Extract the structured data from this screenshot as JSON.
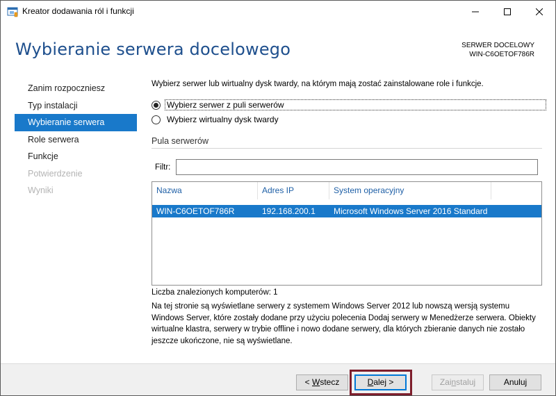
{
  "window": {
    "title": "Kreator dodawania ról i funkcji",
    "app_icon": "server-manager-icon",
    "controls": [
      "minimize-icon",
      "maximize-icon",
      "close-icon"
    ]
  },
  "header": {
    "title": "Wybieranie serwera docelowego",
    "target_label": "SERWER DOCELOWY",
    "target_value": "WIN-C6OETOF786R"
  },
  "nav": {
    "items": [
      {
        "label": "Zanim rozpoczniesz",
        "state": "normal"
      },
      {
        "label": "Typ instalacji",
        "state": "normal"
      },
      {
        "label": "Wybieranie serwera",
        "state": "active"
      },
      {
        "label": "Role serwera",
        "state": "normal"
      },
      {
        "label": "Funkcje",
        "state": "normal"
      },
      {
        "label": "Potwierdzenie",
        "state": "disabled"
      },
      {
        "label": "Wyniki",
        "state": "disabled"
      }
    ]
  },
  "main": {
    "description": "Wybierz serwer lub wirtualny dysk twardy, na którym mają zostać zainstalowane role i funkcje.",
    "options": [
      {
        "label": "Wybierz serwer z puli serwerów",
        "selected": true
      },
      {
        "label": "Wybierz wirtualny dysk twardy",
        "selected": false
      }
    ],
    "pool": {
      "title": "Pula serwerów",
      "filter_label": "Filtr:",
      "filter_value": "",
      "columns": [
        "Nazwa",
        "Adres IP",
        "System operacyjny"
      ],
      "rows": [
        {
          "name": "WIN-C6OETOF786R",
          "ip": "192.168.200.1",
          "os": "Microsoft Windows Server 2016 Standard",
          "selected": true
        }
      ]
    },
    "count_label": "Liczba znalezionych komputerów: 1",
    "note": "Na tej stronie są wyświetlane serwery z systemem Windows Server 2012 lub nowszą wersją systemu Windows Server, które zostały dodane przy użyciu polecenia Dodaj serwery w Menedżerze serwera. Obiekty wirtualne klastra, serwery w trybie offline i nowo dodane serwery, dla których zbieranie danych nie zostało jeszcze ukończone, nie są wyświetlane."
  },
  "footer": {
    "back_prefix": "< ",
    "back_key": "W",
    "back_rest": "stecz",
    "next_key": "D",
    "next_rest": "alej >",
    "install_pre": "Zai",
    "install_key": "n",
    "install_post": "staluj",
    "cancel_label": "Anuluj"
  },
  "colors": {
    "accent": "#1979ca",
    "title": "#1e4f8d",
    "highlight_box": "#7e1e2c"
  }
}
